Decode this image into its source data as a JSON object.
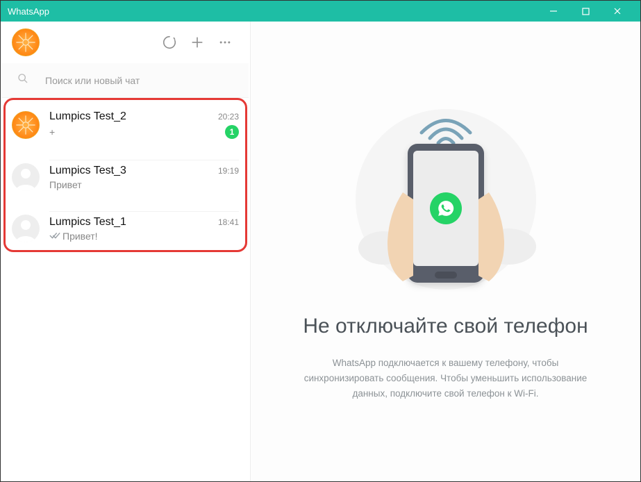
{
  "window": {
    "title": "WhatsApp"
  },
  "sidebar": {
    "search_placeholder": "Поиск или новый чат"
  },
  "chats": [
    {
      "name": "Lumpics Test_2",
      "time": "20:23",
      "preview": "+",
      "unread": "1",
      "avatar": "orange",
      "checks": false
    },
    {
      "name": "Lumpics Test_3",
      "time": "19:19",
      "preview": "Привет",
      "unread": "",
      "avatar": "default",
      "checks": false
    },
    {
      "name": "Lumpics Test_1",
      "time": "18:41",
      "preview": "Привет!",
      "unread": "",
      "avatar": "default",
      "checks": true
    }
  ],
  "main": {
    "title": "Не отключайте свой телефон",
    "subtitle": "WhatsApp подключается к вашему телефону, чтобы синхронизировать сообщения. Чтобы уменьшить использование данных, подключите свой телефон к Wi-Fi."
  }
}
